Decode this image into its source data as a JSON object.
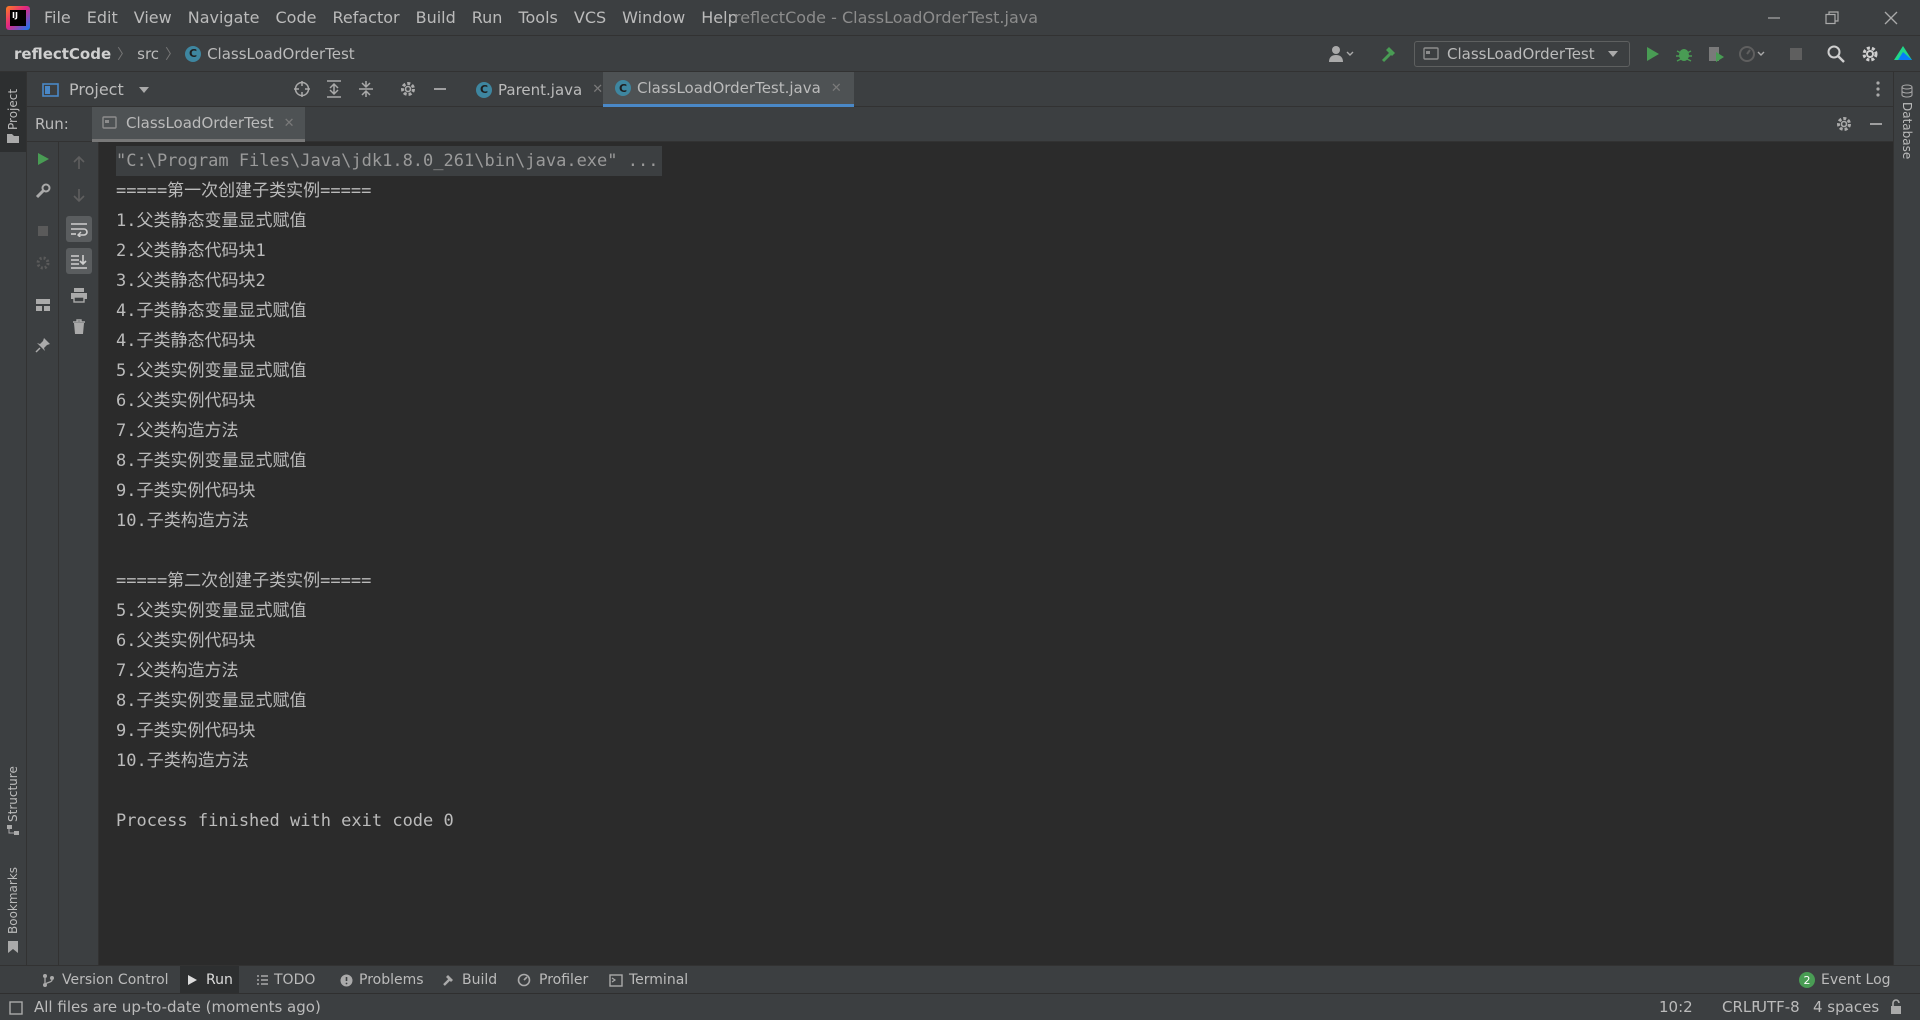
{
  "menu": {
    "items": [
      "File",
      "Edit",
      "View",
      "Navigate",
      "Code",
      "Refactor",
      "Build",
      "Run",
      "Tools",
      "VCS",
      "Window",
      "Help"
    ]
  },
  "window_title": "reflectCode - ClassLoadOrderTest.java",
  "breadcrumb": {
    "project": "reflectCode",
    "folder": "src",
    "file": "ClassLoadOrderTest"
  },
  "run_config": {
    "name": "ClassLoadOrderTest"
  },
  "project_panel": {
    "title": "Project"
  },
  "editor_tabs": [
    {
      "label": "Parent.java",
      "active": false
    },
    {
      "label": "ClassLoadOrderTest.java",
      "active": true
    }
  ],
  "stripe": {
    "project": "Project",
    "structure": "Structure",
    "bookmarks": "Bookmarks",
    "database": "Database"
  },
  "run_panel": {
    "label": "Run:",
    "tab": "ClassLoadOrderTest"
  },
  "console": {
    "command": "\"C:\\Program Files\\Java\\jdk1.8.0_261\\bin\\java.exe\" ...",
    "lines": [
      "=====第一次创建子类实例=====",
      "1.父类静态变量显式赋值",
      "2.父类静态代码块1",
      "3.父类静态代码块2",
      "4.子类静态变量显式赋值",
      "4.子类静态代码块",
      "5.父类实例变量显式赋值",
      "6.父类实例代码块",
      "7.父类构造方法",
      "8.子类实例变量显式赋值",
      "9.子类实例代码块",
      "10.子类构造方法",
      "",
      "=====第二次创建子类实例=====",
      "5.父类实例变量显式赋值",
      "6.父类实例代码块",
      "7.父类构造方法",
      "8.子类实例变量显式赋值",
      "9.子类实例代码块",
      "10.子类构造方法",
      "",
      "Process finished with exit code 0"
    ]
  },
  "bottom_tabs": {
    "version_control": "Version Control",
    "run": "Run",
    "todo": "TODO",
    "problems": "Problems",
    "build": "Build",
    "profiler": "Profiler",
    "terminal": "Terminal",
    "event_log": "Event Log",
    "event_log_count": "2"
  },
  "status": {
    "message": "All files are up-to-date (moments ago)",
    "position": "10:2",
    "line_ending": "CRLF",
    "encoding": "UTF-8",
    "indent": "4 spaces"
  },
  "colors": {
    "accent": "#4a88c7",
    "run_green": "#499c54",
    "background": "#2b2b2b",
    "panel": "#3c3f41"
  }
}
